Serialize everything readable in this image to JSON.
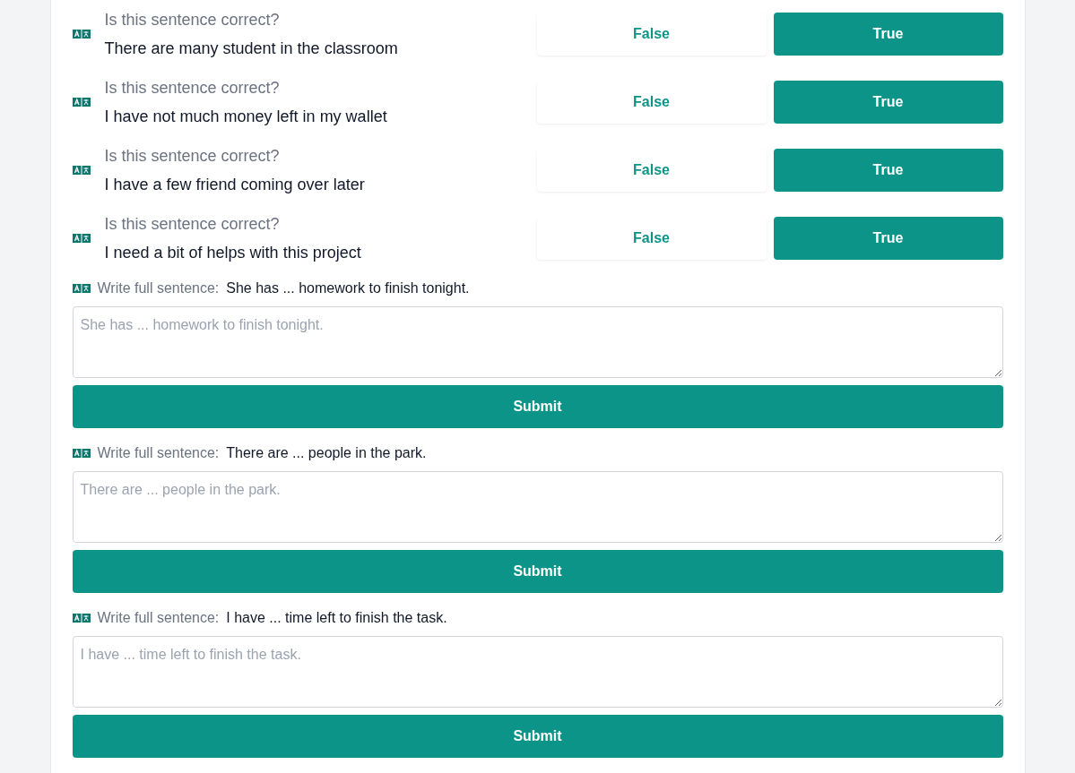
{
  "questions": [
    {
      "prompt": "Is this sentence correct?",
      "sentence": "There are many student in the classroom",
      "options": [
        {
          "label": "False",
          "kind": "outline"
        },
        {
          "label": "True",
          "kind": "filled"
        }
      ]
    },
    {
      "prompt": "Is this sentence correct?",
      "sentence": "I have not much money left in my wallet",
      "options": [
        {
          "label": "False",
          "kind": "outline"
        },
        {
          "label": "True",
          "kind": "filled"
        }
      ]
    },
    {
      "prompt": "Is this sentence correct?",
      "sentence": "I have a few friend coming over later",
      "options": [
        {
          "label": "False",
          "kind": "outline"
        },
        {
          "label": "True",
          "kind": "filled"
        }
      ]
    },
    {
      "prompt": "Is this sentence correct?",
      "sentence": "I need a bit of helps with this project",
      "options": [
        {
          "label": "False",
          "kind": "outline"
        },
        {
          "label": "True",
          "kind": "filled"
        }
      ]
    }
  ],
  "writing": [
    {
      "label": "Write full sentence:",
      "sentence": "She has ... homework to finish tonight.",
      "placeholder": "She has ... homework to finish tonight.",
      "button": "Submit"
    },
    {
      "label": "Write full sentence:",
      "sentence": "There are ... people in the park.",
      "placeholder": "There are ... people in the park.",
      "button": "Submit"
    },
    {
      "label": "Write full sentence:",
      "sentence": "I have ... time left to finish the task.",
      "placeholder": "I have ... time left to finish the task.",
      "button": "Submit"
    }
  ]
}
